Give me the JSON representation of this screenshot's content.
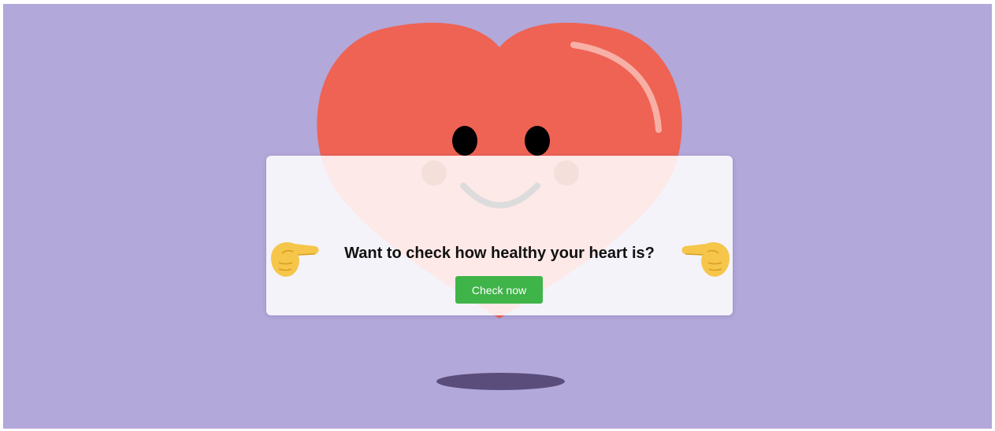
{
  "scene": {
    "background_color": "#b2a8d9",
    "heart_color": "#ee6354",
    "shadow_color": "#5a4d7c",
    "icons": [
      "heart-mascot-icon",
      "pointing-right-hand-icon",
      "pointing-left-hand-icon"
    ]
  },
  "card": {
    "prompt": "Want to check how healthy your heart is?",
    "button_label": "Check now",
    "button_color": "#3fb449"
  }
}
